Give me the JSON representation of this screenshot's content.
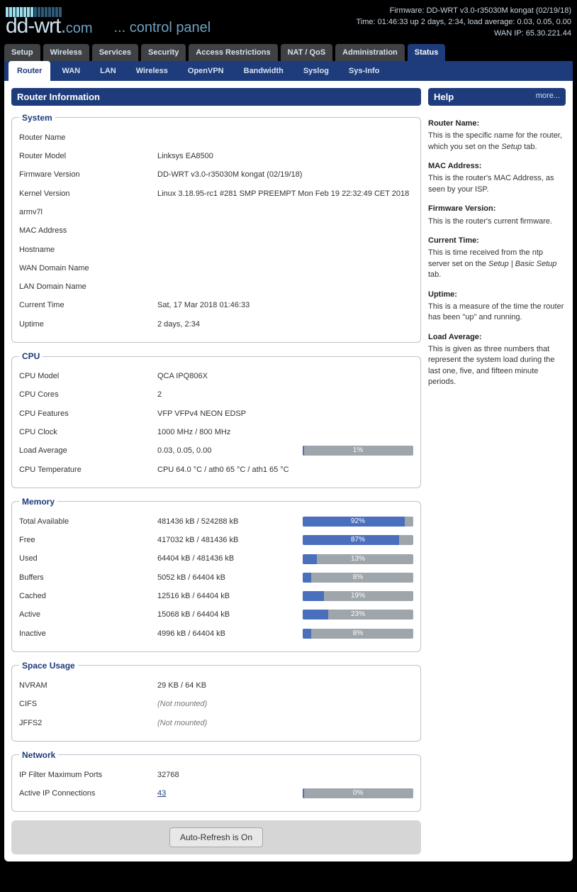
{
  "header": {
    "brand_dd": "dd",
    "brand_wrt": "-wrt",
    "brand_dot": ".",
    "brand_com": "com",
    "subtitle": "... control panel",
    "firmware_line": "Firmware: DD-WRT v3.0-r35030M kongat (02/19/18)",
    "time_line": "Time: 01:46:33 up 2 days, 2:34, load average: 0.03, 0.05, 0.00",
    "wanip_line": "WAN IP: 65.30.221.44"
  },
  "tabs1": [
    "Setup",
    "Wireless",
    "Services",
    "Security",
    "Access Restrictions",
    "NAT / QoS",
    "Administration",
    "Status"
  ],
  "tabs1_active": "Status",
  "tabs2": [
    "Router",
    "WAN",
    "LAN",
    "Wireless",
    "OpenVPN",
    "Bandwidth",
    "Syslog",
    "Sys-Info"
  ],
  "tabs2_active": "Router",
  "page_title": "Router Information",
  "system": {
    "legend": "System",
    "rows": {
      "routerName": {
        "label": "Router Name",
        "value": ""
      },
      "routerModel": {
        "label": "Router Model",
        "value": "Linksys EA8500"
      },
      "fwVersion": {
        "label": "Firmware Version",
        "value": "DD-WRT v3.0-r35030M kongat (02/19/18)"
      },
      "kernel": {
        "label": "Kernel Version",
        "value": "Linux 3.18.95-rc1 #281 SMP PREEMPT Mon Feb 19 22:32:49 CET 2018 armv7l"
      },
      "mac": {
        "label": "MAC Address",
        "value": ""
      },
      "hostname": {
        "label": "Hostname",
        "value": ""
      },
      "wanDomain": {
        "label": "WAN Domain Name",
        "value": ""
      },
      "lanDomain": {
        "label": "LAN Domain Name",
        "value": ""
      },
      "curTime": {
        "label": "Current Time",
        "value": "Sat, 17 Mar 2018 01:46:33"
      },
      "uptime": {
        "label": "Uptime",
        "value": "2 days, 2:34"
      }
    }
  },
  "cpu": {
    "legend": "CPU",
    "rows": {
      "model": {
        "label": "CPU Model",
        "value": "QCA IPQ806X"
      },
      "cores": {
        "label": "CPU Cores",
        "value": "2"
      },
      "features": {
        "label": "CPU Features",
        "value": "VFP VFPv4 NEON EDSP"
      },
      "clock": {
        "label": "CPU Clock",
        "value": "1000 MHz / 800 MHz"
      },
      "load": {
        "label": "Load Average",
        "value": "0.03, 0.05, 0.00",
        "pct": 1
      },
      "temp": {
        "label": "CPU Temperature",
        "value": "CPU 64.0 °C / ath0 65 °C / ath1 65 °C"
      }
    }
  },
  "memory": {
    "legend": "Memory",
    "rows": {
      "total": {
        "label": "Total Available",
        "value": "481436 kB / 524288 kB",
        "pct": 92
      },
      "free": {
        "label": "Free",
        "value": "417032 kB / 481436 kB",
        "pct": 87
      },
      "used": {
        "label": "Used",
        "value": "64404 kB / 481436 kB",
        "pct": 13
      },
      "buffers": {
        "label": "Buffers",
        "value": "5052 kB / 64404 kB",
        "pct": 8
      },
      "cached": {
        "label": "Cached",
        "value": "12516 kB / 64404 kB",
        "pct": 19
      },
      "active": {
        "label": "Active",
        "value": "15068 kB / 64404 kB",
        "pct": 23
      },
      "inactive": {
        "label": "Inactive",
        "value": "4996 kB / 64404 kB",
        "pct": 8
      }
    }
  },
  "space": {
    "legend": "Space Usage",
    "rows": {
      "nvram": {
        "label": "NVRAM",
        "value": "29 KB / 64 KB"
      },
      "cifs": {
        "label": "CIFS",
        "value": "(Not mounted)",
        "ital": true
      },
      "jffs2": {
        "label": "JFFS2",
        "value": "(Not mounted)",
        "ital": true
      }
    }
  },
  "network": {
    "legend": "Network",
    "rows": {
      "ipfilter": {
        "label": "IP Filter Maximum Ports",
        "value": "32768"
      },
      "activeip": {
        "label": "Active IP Connections",
        "value": "43",
        "link": true,
        "pct": 0
      }
    }
  },
  "help": {
    "title": "Help",
    "more": "more...",
    "sections": [
      {
        "h": "Router Name:",
        "p": "This is the specific name for the router, which you set on the <i>Setup</i> tab."
      },
      {
        "h": "MAC Address:",
        "p": "This is the router's MAC Address, as seen by your ISP."
      },
      {
        "h": "Firmware Version:",
        "p": "This is the router's current firmware."
      },
      {
        "h": "Current Time:",
        "p": "This is time received from the ntp server set on the <i>Setup | Basic Setup</i> tab."
      },
      {
        "h": "Uptime:",
        "p": "This is a measure of the time the router has been \"up\" and running."
      },
      {
        "h": "Load Average:",
        "p": "This is given as three numbers that represent the system load during the last one, five, and fifteen minute periods."
      }
    ]
  },
  "footer": {
    "button": "Auto-Refresh is On"
  }
}
